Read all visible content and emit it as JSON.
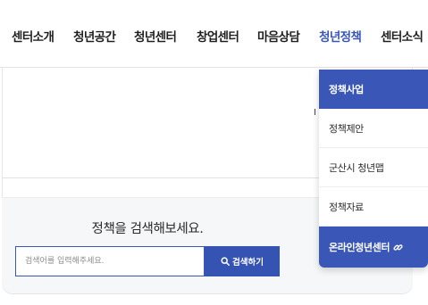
{
  "nav": {
    "items": [
      {
        "label": "센터소개"
      },
      {
        "label": "청년공간"
      },
      {
        "label": "청년센터"
      },
      {
        "label": "창업센터"
      },
      {
        "label": "마음상담"
      },
      {
        "label": "청년정책",
        "active": true
      },
      {
        "label": "센터소식"
      }
    ],
    "active_color": "#3a57b8"
  },
  "dropdown": {
    "items": [
      {
        "label": "정책사업",
        "highlighted": true
      },
      {
        "label": "정책제안"
      },
      {
        "label": "군산시 청년맵"
      },
      {
        "label": "정책자료"
      },
      {
        "label": "온라인청년센터",
        "highlighted": true,
        "icon": "link-icon"
      }
    ],
    "highlight_color": "#3a57b8"
  },
  "search": {
    "title": "정책을 검색해보세요.",
    "placeholder": "검색어를 입력해주세요.",
    "button_label": "검색하기",
    "button_icon": "search-icon",
    "button_color": "#3553b3"
  }
}
